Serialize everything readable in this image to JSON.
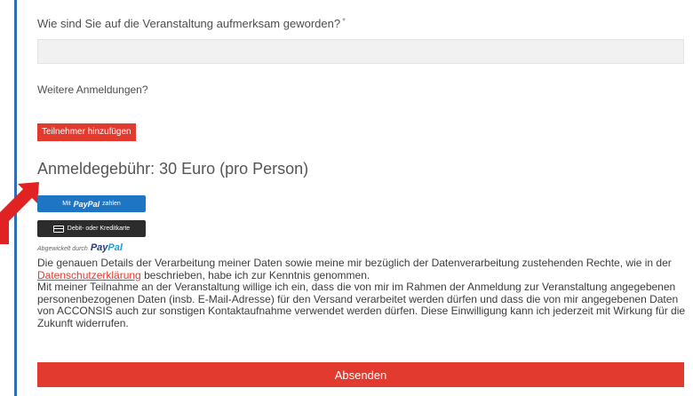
{
  "question": {
    "label": "Wie sind Sie auf die Veranstaltung aufmerksam geworden?",
    "required_mark": "*",
    "value": ""
  },
  "more_registrations": {
    "label": "Weitere Anmeldungen?",
    "add_button": "Teilnehmer hinzufügen"
  },
  "fee": {
    "title": "Anmeldegebühr: 30 Euro (pro Person)"
  },
  "payment": {
    "paypal_prefix": "Mit",
    "paypal_word": "PayPal",
    "paypal_suffix": "zahlen",
    "card_label": "Debit- oder Kreditkarte",
    "powered_by": "Abgewickelt durch",
    "logo_pay": "Pay",
    "logo_pal": "Pal",
    "paypal_color": "#1e75c4",
    "card_color": "#2c2c2c"
  },
  "privacy": {
    "part1": "Die genauen Details der Verarbeitung meiner Daten sowie meine mir bezüglich der Datenverarbeitung zustehenden Rechte, wie in der ",
    "link": "Datenschutzerklärung",
    "part2": " beschrieben, habe ich zur Kenntnis genommen.",
    "consent": "Mit meiner Teilnahme an der Veranstaltung willige ich ein, dass die von mir im Rahmen der Anmeldung zur Veranstaltung angegebenen personenbezogenen Daten (insb. E-Mail-Adresse) für den Versand verarbeitet werden dürfen und dass die von mir angegebenen Daten von ACCONSIS auch zur sonstigen Kontaktaufnahme verwendet werden dürfen. Diese Einwilligung kann ich jederzeit mit Wirkung für die Zukunft widerrufen."
  },
  "submit": {
    "label": "Absenden"
  },
  "colors": {
    "accent_red": "#e33a2f",
    "frame_blue": "#2f6db5"
  }
}
